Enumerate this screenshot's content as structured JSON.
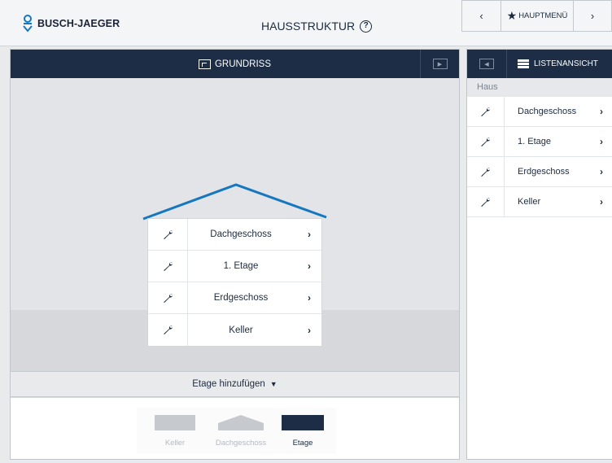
{
  "header": {
    "brand": "BUSCH-JAEGER",
    "title": "HAUSSTRUKTUR",
    "help_glyph": "?",
    "back_glyph": "‹",
    "forward_glyph": "›",
    "main_menu_label": "HAUPTMENÜ",
    "main_menu_icon": "star-icon"
  },
  "floorplan": {
    "title": "GRUNDRISS",
    "floors": [
      {
        "label": "Dachgeschoss",
        "icon": "wrench-icon"
      },
      {
        "label": "1. Etage",
        "icon": "wrench-icon"
      },
      {
        "label": "Erdgeschoss",
        "icon": "wrench-icon"
      },
      {
        "label": "Keller",
        "icon": "wrench-icon"
      }
    ],
    "add_floor_label": "Etage hinzufügen",
    "floor_types": [
      "Keller",
      "Dachgeschoss",
      "Etage"
    ],
    "selected_floor_type": "Etage"
  },
  "list_view": {
    "title": "LISTENANSICHT",
    "breadcrumb": "Haus",
    "items": [
      {
        "label": "Dachgeschoss",
        "icon": "wrench-icon"
      },
      {
        "label": "1. Etage",
        "icon": "wrench-icon"
      },
      {
        "label": "Erdgeschoss",
        "icon": "wrench-icon"
      },
      {
        "label": "Keller",
        "icon": "wrench-icon"
      }
    ]
  },
  "colors": {
    "navy": "#1c2d45",
    "accent_blue": "#1577c0",
    "panel_grey": "#d5d8dc"
  }
}
